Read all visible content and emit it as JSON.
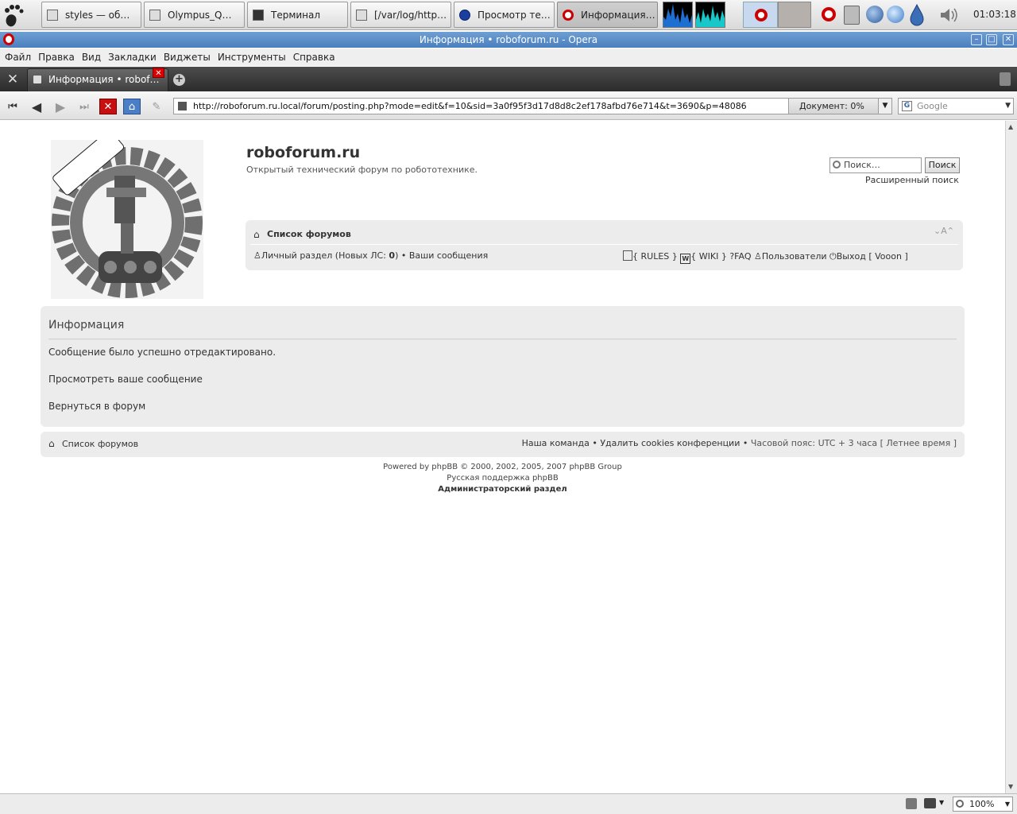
{
  "taskbar": {
    "tasks": [
      "styles — об…",
      "Olympus_Q…",
      "Терминал",
      "[/var/log/http…",
      "Просмотр те…",
      "Информация…"
    ],
    "clock": "01:03:18"
  },
  "window": {
    "title": "Информация • roboforum.ru - Opera"
  },
  "menu": [
    "Файл",
    "Правка",
    "Вид",
    "Закладки",
    "Виджеты",
    "Инструменты",
    "Справка"
  ],
  "tab": {
    "label": "Информация • robof…"
  },
  "address": {
    "url": "http://roboforum.ru.local/forum/posting.php?mode=edit&f=10&sid=3a0f95f3d17d8d8c2ef178afbd76e714&t=3690&p=48086",
    "progress": "Документ:   0%",
    "search_placeholder": "Google"
  },
  "site": {
    "name": "roboforum.ru",
    "description": "Открытый технический форум по робототехнике.",
    "logo_text": "www.roboforum.ru",
    "logo_ring_text": "Открытый технический форум по робототехнике"
  },
  "search": {
    "placeholder": "Поиск…",
    "button": "Поиск",
    "advanced": "Расширенный поиск"
  },
  "navbar": {
    "forum_index": "Список форумов",
    "font_size": "A",
    "pm_prefix": "Личный раздел (Новых ЛС: ",
    "pm_count": "0",
    "pm_suffix": ")",
    "bullet": "•",
    "your_posts": "Ваши сообщения",
    "rules": "{ RULES }",
    "wiki": "{ WIKI }",
    "faq": "FAQ",
    "members": "Пользователи",
    "logout": "Выход [ Vooon ]"
  },
  "info": {
    "title": "Информация",
    "message": "Сообщение было успешно отредактировано.",
    "view_post": "Просмотреть ваше сообщение",
    "return_forum": "Вернуться в форум"
  },
  "footer_nav": {
    "forum_index": "Список форумов",
    "team": "Наша команда",
    "delete_cookies": "Удалить cookies конференции",
    "timezone": "Часовой пояс: UTC + 3 часа [ Летнее время ]"
  },
  "copyright": {
    "powered": "Powered by phpBB © 2000, 2002, 2005, 2007 phpBB Group",
    "support": "Русская поддержка phpBB",
    "admin": "Администраторский раздел"
  },
  "status": {
    "zoom": "100%"
  },
  "colors": {
    "titlebar": "#4a7fbf",
    "panel": "#ececec",
    "tabbar": "#3a3a3a",
    "close": "#d00000"
  }
}
